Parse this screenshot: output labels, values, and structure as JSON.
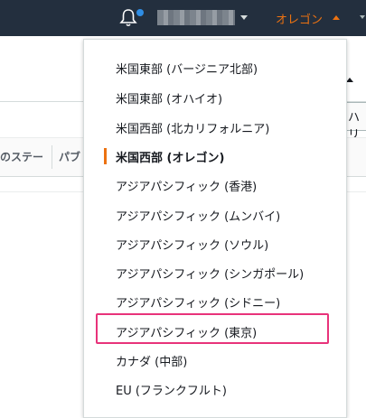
{
  "header": {
    "region_label": "オレゴン",
    "notifications_icon": "bell-icon",
    "account_icon": "blurred-account-name",
    "colors": {
      "background": "#232f3e",
      "accent": "#ec7211",
      "notification_dot": "#2f8de4"
    }
  },
  "background_page": {
    "right_cut_text": "ハリ",
    "columns": [
      "のステー",
      "パブ"
    ]
  },
  "region_menu": {
    "selected": "米国西部 (オレゴン)",
    "items": [
      {
        "label": "米国東部 (バージニア北部)"
      },
      {
        "label": "米国東部 (オハイオ)"
      },
      {
        "label": "米国西部 (北カリフォルニア)"
      },
      {
        "label": "米国西部 (オレゴン)"
      },
      {
        "label": "アジアパシフィック (香港)"
      },
      {
        "label": "アジアパシフィック (ムンバイ)"
      },
      {
        "label": "アジアパシフィック (ソウル)"
      },
      {
        "label": "アジアパシフィック (シンガポール)"
      },
      {
        "label": "アジアパシフィック (シドニー)"
      },
      {
        "label": "アジアパシフィック (東京)"
      },
      {
        "label": "カナダ (中部)"
      },
      {
        "label": "EU (フランクフルト)"
      }
    ],
    "highlight_color": "#e8337a"
  }
}
